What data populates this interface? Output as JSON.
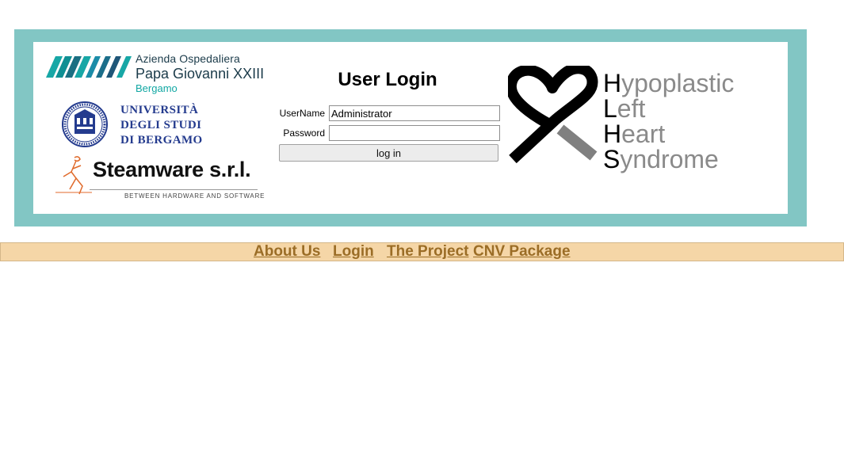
{
  "header": {
    "hospital": {
      "mark": "XXIII",
      "line1": "Azienda Ospedaliera",
      "line2": "Papa Giovanni XXIII",
      "line3": "Bergamo"
    },
    "university": {
      "line1": "UNIVERSITÀ",
      "line2": "DEGLI STUDI",
      "line3": "DI BERGAMO"
    },
    "company": {
      "name": "Steamware s.r.l.",
      "tagline": "BETWEEN HARDWARE AND SOFTWARE"
    },
    "project_logo": {
      "icon": "heart-ribbon-icon",
      "words": [
        {
          "cap": "H",
          "rest": "ypoplastic"
        },
        {
          "cap": "L",
          "rest": "eft"
        },
        {
          "cap": "H",
          "rest": "eart"
        },
        {
          "cap": "S",
          "rest": "yndrome"
        }
      ]
    }
  },
  "login": {
    "title": "User Login",
    "username_label": "UserName",
    "username_value": "Administrator",
    "password_label": "Password",
    "password_value": "",
    "submit_label": "log in"
  },
  "nav": {
    "items": [
      {
        "label": "About Us"
      },
      {
        "label": "Login"
      },
      {
        "label": "The Project"
      },
      {
        "label": "CNV Package"
      }
    ]
  },
  "colors": {
    "frame": "#82c6c4",
    "nav_background": "#f5d6a7",
    "nav_link": "#9b6d26",
    "university_blue": "#243b8e",
    "hospital_teal": "#11a7a3"
  }
}
